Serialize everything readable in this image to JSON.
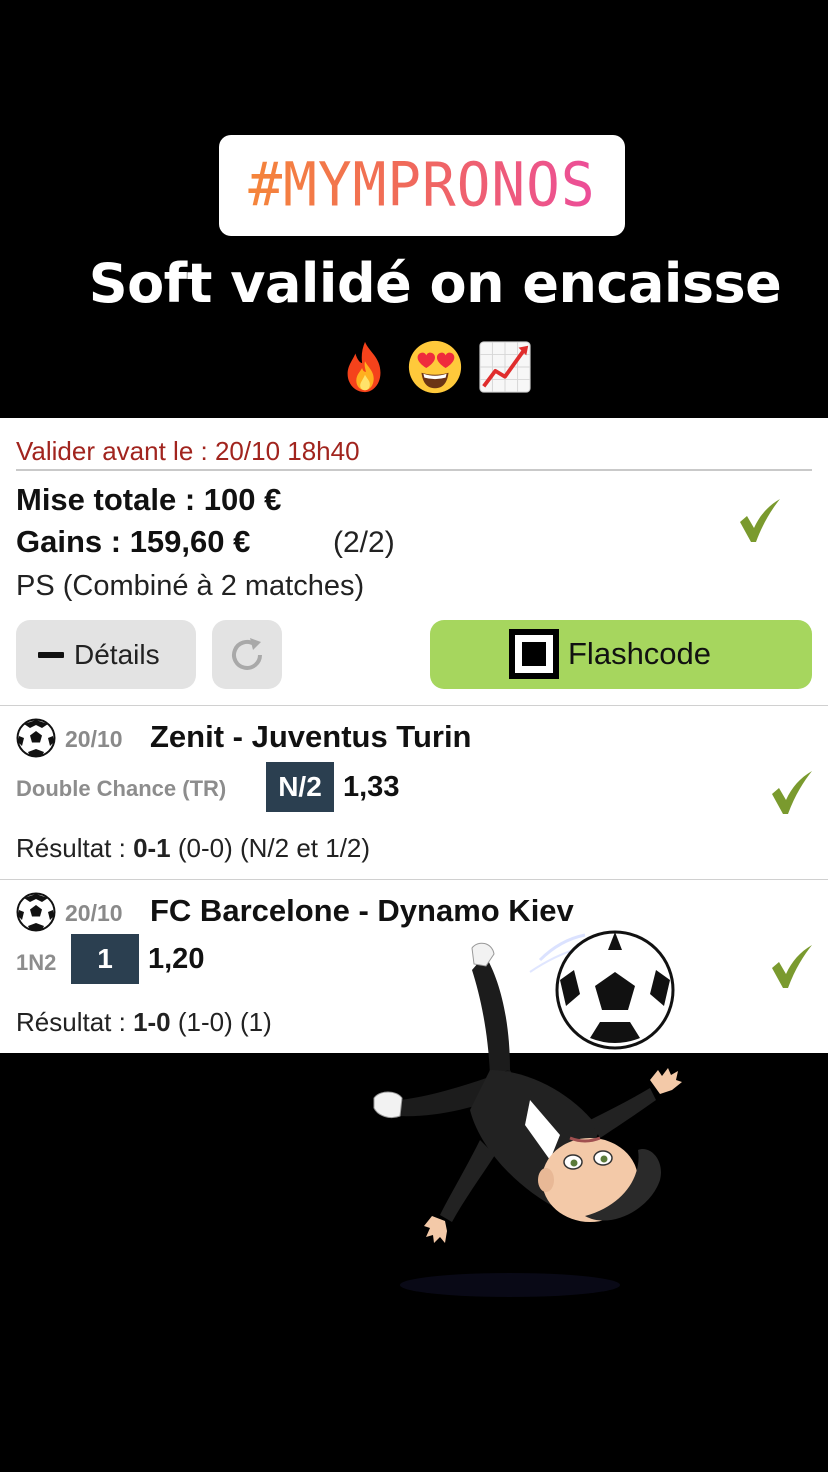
{
  "story": {
    "hashtag": "#MYMPRONOS",
    "caption": "Soft validé on encaisse",
    "emojis": [
      "fire-emoji",
      "heart-eyes-emoji",
      "chart-increasing-emoji"
    ]
  },
  "bet": {
    "deadline": "Valider avant le : 20/10 18h40",
    "stake_label": "Mise totale : 100 €",
    "gains_label": "Gains : 159,60 €",
    "gains_count": "(2/2)",
    "bet_type": "PS (Combiné à 2 matches)",
    "status": "won",
    "buttons": {
      "details": "Détails",
      "flashcode": "Flashcode"
    }
  },
  "matches": [
    {
      "date": "20/10",
      "teams": "Zenit - Juventus Turin",
      "market": "Double Chance (TR)",
      "pick": "N/2",
      "odds": "1,33",
      "result_label": "Résultat : ",
      "score": "0-1",
      "result_detail": " (0-0) (N/2 et 1/2)",
      "status": "won"
    },
    {
      "date": "20/10",
      "teams": "FC Barcelone - Dynamo Kiev",
      "market": "1N2",
      "pick": "1",
      "odds": "1,20",
      "result_label": "Résultat : ",
      "score": "1-0",
      "result_detail": " (1-0) (1)",
      "status": "won"
    }
  ],
  "colors": {
    "deadline": "#a1241e",
    "check": "#7a9a2e",
    "flash_button": "#a6d65e",
    "pick_box": "#2b3f50",
    "hashtag_gradient": [
      "#f5853a",
      "#ec4d9a"
    ]
  }
}
